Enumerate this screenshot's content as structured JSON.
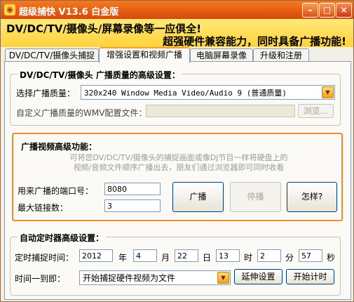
{
  "window": {
    "title": "超级捕快 V13.6 白金版",
    "controls": {
      "minimize": "–",
      "maximize": "□",
      "close": "×"
    }
  },
  "banner": {
    "line1": "DV/DC/TV/摄像头/屏幕录像等一应俱全!",
    "line2": "超强硬件兼容能力，同时具备广播功能!"
  },
  "tabs": [
    {
      "label": "DV/DC/TV/摄像头捕捉",
      "active": false
    },
    {
      "label": "增强设置和视频广播",
      "active": true
    },
    {
      "label": "电脑屏幕录像",
      "active": false
    },
    {
      "label": "升级和注册",
      "active": false
    }
  ],
  "quality_group": {
    "title": "DV/DC/TV/摄像头 广播质量的高级设置：",
    "select_label": "选择广播质量：",
    "select_value": "320x240 Window Media Video/Audio 9 (普通质量)",
    "wmv_label": "自定义广播质量的WMV配置文件：",
    "wmv_value": "",
    "browse_label": "浏览..."
  },
  "broadcast_group": {
    "title": "广播视频高级功能：",
    "desc_line1": "可将您DV/DC/TV/摄像头的捕捉画面或像DJ节目一样将硬盘上的",
    "desc_line2": "视频/音频文件顺序广播出去，朋友们通过浏览器即可同时收看",
    "port_label": "用来广播的端口号：",
    "port_value": "8080",
    "maxconn_label": "最大链接数：",
    "maxconn_value": "3",
    "broadcast_button": "广播",
    "stop_button": "停播",
    "how_button": "怎样?"
  },
  "timer_group": {
    "title": "自动定时器高级设置：",
    "time_label": "定时捕捉时间：",
    "year": "2012",
    "year_unit": "年",
    "month": "4",
    "month_unit": "月",
    "day": "22",
    "day_unit": "日",
    "hour": "13",
    "hour_unit": "时",
    "minute": "2",
    "minute_unit": "分",
    "second": "57",
    "second_unit": "秒",
    "action_label": "时间一到即：",
    "action_value": "开始捕捉硬件视频为文件",
    "delay_button": "延伸设置",
    "start_button": "开始计时"
  }
}
